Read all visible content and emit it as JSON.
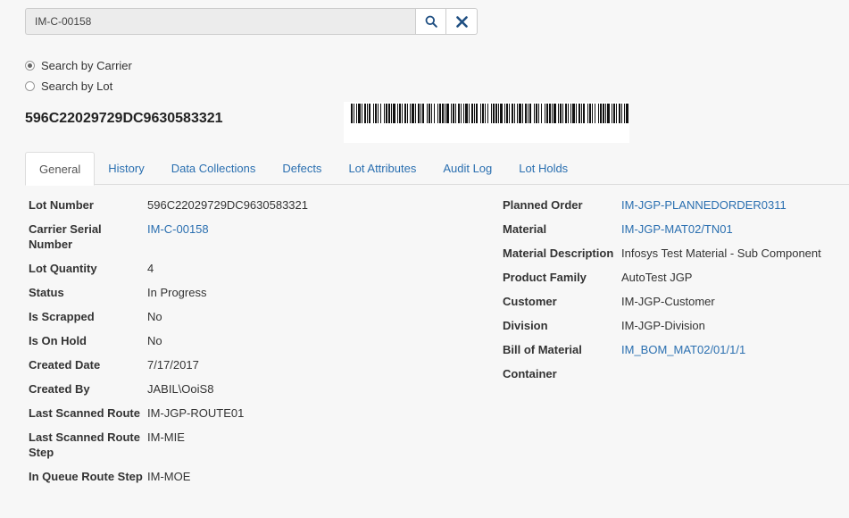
{
  "search": {
    "value": "IM-C-00158",
    "search_icon": "search-icon",
    "clear_icon": "close-icon"
  },
  "search_options": [
    {
      "label": "Search by Carrier",
      "checked": true
    },
    {
      "label": "Search by Lot",
      "checked": false
    }
  ],
  "lot_title": "596C22029729DC9630583321",
  "tabs": [
    {
      "label": "General"
    },
    {
      "label": "History"
    },
    {
      "label": "Data Collections"
    },
    {
      "label": "Defects"
    },
    {
      "label": "Lot Attributes"
    },
    {
      "label": "Audit Log"
    },
    {
      "label": "Lot Holds"
    }
  ],
  "left_fields": [
    {
      "label": "Lot Number",
      "value": "596C22029729DC9630583321"
    },
    {
      "label": "Carrier Serial Number",
      "value": "IM-C-00158"
    },
    {
      "label": "Lot Quantity",
      "value": "4"
    },
    {
      "label": "Status",
      "value": "In Progress"
    },
    {
      "label": "Is Scrapped",
      "value": "No"
    },
    {
      "label": "Is On Hold",
      "value": "No"
    },
    {
      "label": "Created Date",
      "value": "7/17/2017"
    },
    {
      "label": "Created By",
      "value": "JABIL\\OoiS8"
    },
    {
      "label": "Last Scanned Route",
      "value": "IM-JGP-ROUTE01"
    },
    {
      "label": "Last Scanned Route Step",
      "value": "IM-MIE"
    },
    {
      "label": "In Queue Route Step",
      "value": "IM-MOE"
    }
  ],
  "right_fields": [
    {
      "label": "Planned Order",
      "value": "IM-JGP-PLANNEDORDER0311"
    },
    {
      "label": "Material",
      "value": "IM-JGP-MAT02/TN01"
    },
    {
      "label": "Material Description",
      "value": "Infosys Test Material - Sub Component"
    },
    {
      "label": "Product Family",
      "value": "AutoTest JGP"
    },
    {
      "label": "Customer",
      "value": "IM-JGP-Customer"
    },
    {
      "label": "Division",
      "value": "IM-JGP-Division"
    },
    {
      "label": "Bill of Material",
      "value": "IM_BOM_MAT02/01/1/1"
    },
    {
      "label": "Container",
      "value": ""
    }
  ],
  "colors": {
    "link": "#2a6fb0",
    "icon": "#1f4f82"
  }
}
